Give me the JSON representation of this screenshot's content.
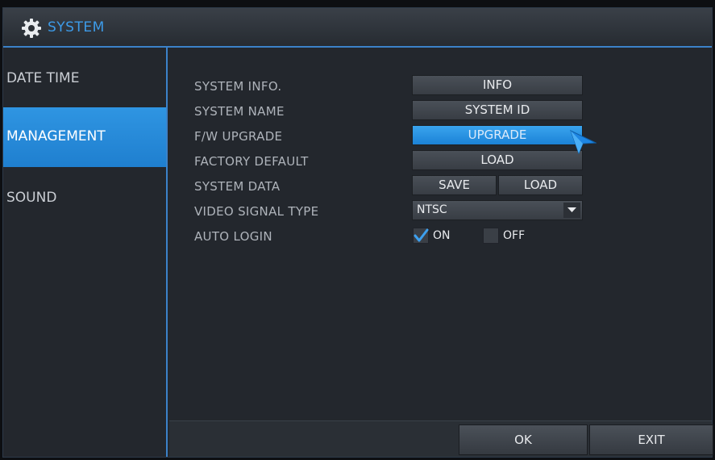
{
  "window": {
    "title": "SYSTEM",
    "icon": "gear-icon"
  },
  "sidebar": {
    "items": [
      {
        "label": "DATE TIME",
        "active": false
      },
      {
        "label": "MANAGEMENT",
        "active": true
      },
      {
        "label": "SOUND",
        "active": false
      }
    ]
  },
  "settings": {
    "system_info": {
      "label": "SYSTEM INFO.",
      "button": "INFO"
    },
    "system_name": {
      "label": "SYSTEM NAME",
      "button": "SYSTEM ID"
    },
    "fw_upgrade": {
      "label": "F/W UPGRADE",
      "button": "UPGRADE"
    },
    "factory_default": {
      "label": "FACTORY DEFAULT",
      "button": "LOAD"
    },
    "system_data": {
      "label": "SYSTEM DATA",
      "save_button": "SAVE",
      "load_button": "LOAD"
    },
    "video_signal_type": {
      "label": "VIDEO SIGNAL TYPE",
      "value": "NTSC"
    },
    "auto_login": {
      "label": "AUTO LOGIN",
      "on_label": "ON",
      "off_label": "OFF",
      "on_checked": true,
      "off_checked": false
    }
  },
  "footer": {
    "ok_label": "OK",
    "exit_label": "EXIT"
  },
  "colors": {
    "accent": "#3b82c9",
    "active_fill": "#2f95e2",
    "title_text": "#3d9be8",
    "check": "#3da0ef"
  }
}
